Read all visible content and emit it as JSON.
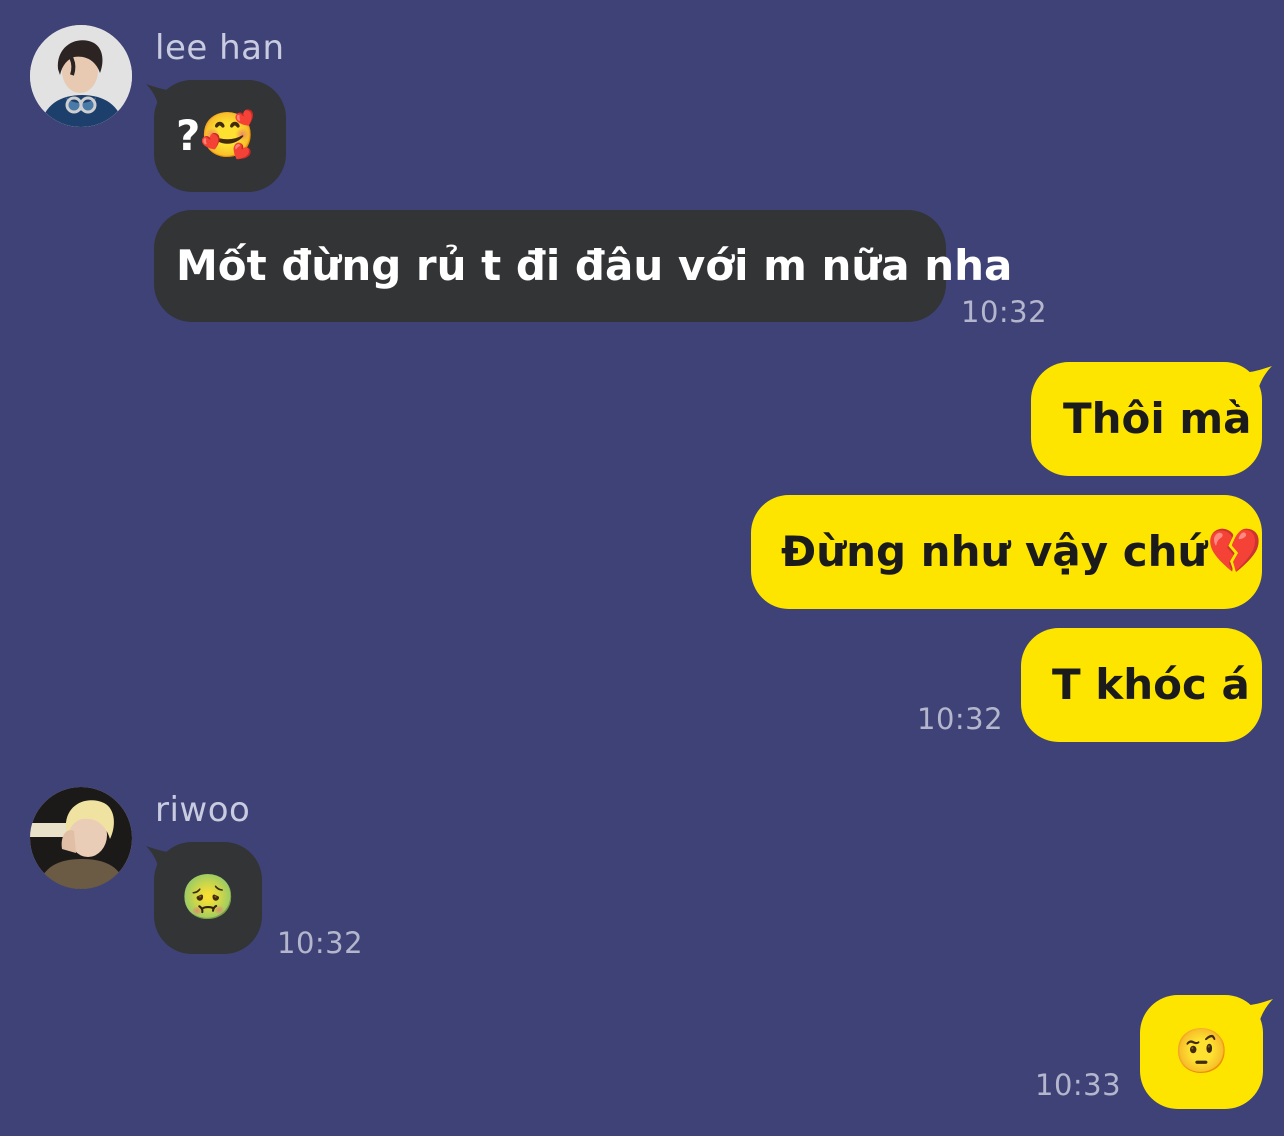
{
  "colors": {
    "background": "#3f4276",
    "incoming_bubble": "#333436",
    "outgoing_bubble": "#fee500",
    "timestamp_text": "#b4b6cd"
  },
  "messages": [
    {
      "sender": "lee han",
      "direction": "incoming",
      "avatar_icon": "profile-photo-icon",
      "text": "?",
      "emoji": "🥰",
      "emoji_icon": "smiling-face-with-hearts-icon"
    },
    {
      "direction": "incoming",
      "text": "Mốt đừng rủ t đi đâu với m nữa nha",
      "time": "10:32"
    },
    {
      "direction": "outgoing",
      "text": "Thôi mà"
    },
    {
      "direction": "outgoing",
      "text": "Đừng như vậy chứ",
      "emoji": "💔",
      "emoji_icon": "broken-heart-icon"
    },
    {
      "direction": "outgoing",
      "text": "T khóc á",
      "time": "10:32"
    },
    {
      "sender": "riwoo",
      "direction": "incoming",
      "avatar_icon": "profile-photo-icon",
      "emoji": "🤢",
      "emoji_icon": "nauseated-face-icon",
      "time": "10:32"
    },
    {
      "direction": "outgoing",
      "emoji": "🤨",
      "emoji_icon": "face-with-raised-eyebrow-icon",
      "time": "10:33"
    }
  ]
}
